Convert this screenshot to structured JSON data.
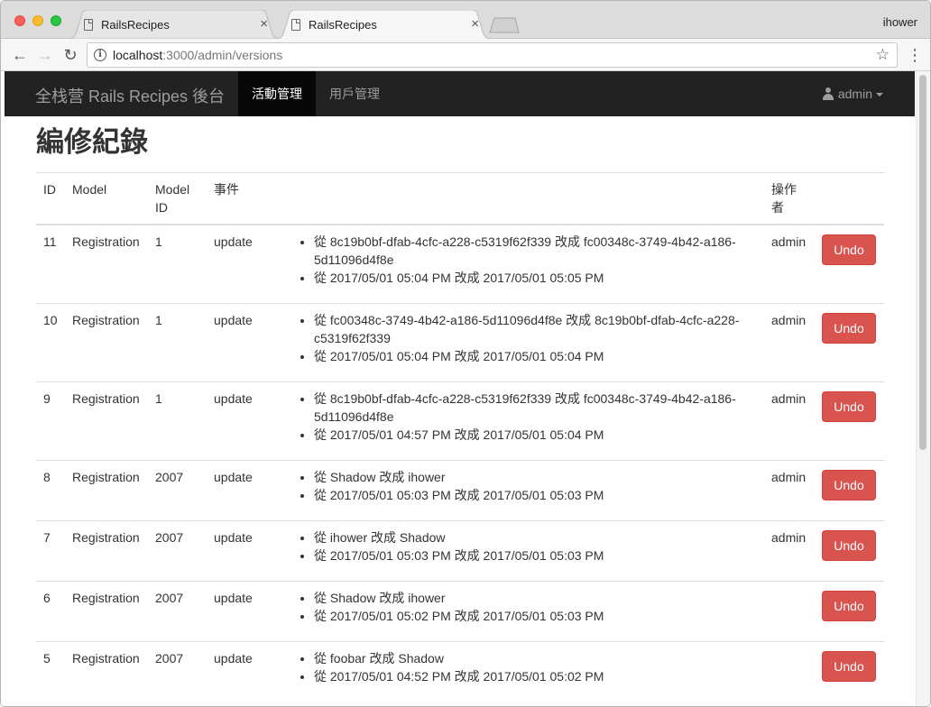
{
  "browser": {
    "tabs": [
      {
        "title": "RailsRecipes",
        "close": "×"
      },
      {
        "title": "RailsRecipes",
        "close": "×"
      }
    ],
    "profile_name": "ihower",
    "url_host": "localhost",
    "url_path": ":3000/admin/versions",
    "info_symbol": "i",
    "star_symbol": "☆",
    "menu_symbol": "⋮",
    "back_symbol": "←",
    "forward_symbol": "→",
    "reload_symbol": "↻"
  },
  "site": {
    "brand": "全栈营 Rails Recipes 後台",
    "nav": [
      {
        "label": "活動管理",
        "active": true
      },
      {
        "label": "用戶管理",
        "active": false
      }
    ],
    "user_menu_label": "admin"
  },
  "page": {
    "title": "編修紀錄",
    "columns": {
      "id": "ID",
      "model": "Model",
      "model_id_line1": "Model",
      "model_id_line2": "ID",
      "event": "事件",
      "changes": "",
      "operator_line1": "操作",
      "operator_line2": "者",
      "actions": ""
    },
    "undo_label": "Undo",
    "rows": [
      {
        "id": "11",
        "model": "Registration",
        "model_id": "1",
        "event": "update",
        "changes": [
          "從 8c19b0bf-dfab-4cfc-a228-c5319f62f339 改成 fc00348c-3749-4b42-a186-5d11096d4f8e",
          "從 2017/05/01 05:04 PM 改成 2017/05/01 05:05 PM"
        ],
        "operator": "admin"
      },
      {
        "id": "10",
        "model": "Registration",
        "model_id": "1",
        "event": "update",
        "changes": [
          "從 fc00348c-3749-4b42-a186-5d11096d4f8e 改成 8c19b0bf-dfab-4cfc-a228-c5319f62f339",
          "從 2017/05/01 05:04 PM 改成 2017/05/01 05:04 PM"
        ],
        "operator": "admin"
      },
      {
        "id": "9",
        "model": "Registration",
        "model_id": "1",
        "event": "update",
        "changes": [
          "從 8c19b0bf-dfab-4cfc-a228-c5319f62f339 改成 fc00348c-3749-4b42-a186-5d11096d4f8e",
          "從 2017/05/01 04:57 PM 改成 2017/05/01 05:04 PM"
        ],
        "operator": "admin"
      },
      {
        "id": "8",
        "model": "Registration",
        "model_id": "2007",
        "event": "update",
        "changes": [
          "從 Shadow 改成 ihower",
          "從 2017/05/01 05:03 PM 改成 2017/05/01 05:03 PM"
        ],
        "operator": "admin"
      },
      {
        "id": "7",
        "model": "Registration",
        "model_id": "2007",
        "event": "update",
        "changes": [
          "從 ihower 改成 Shadow",
          "從 2017/05/01 05:03 PM 改成 2017/05/01 05:03 PM"
        ],
        "operator": "admin"
      },
      {
        "id": "6",
        "model": "Registration",
        "model_id": "2007",
        "event": "update",
        "changes": [
          "從 Shadow 改成 ihower",
          "從 2017/05/01 05:02 PM 改成 2017/05/01 05:03 PM"
        ],
        "operator": ""
      },
      {
        "id": "5",
        "model": "Registration",
        "model_id": "2007",
        "event": "update",
        "changes": [
          "從 foobar 改成 Shadow",
          "從 2017/05/01 04:52 PM 改成 2017/05/01 05:02 PM"
        ],
        "operator": ""
      }
    ]
  },
  "colors": {
    "navbar_bg": "#222222",
    "navbar_active_bg": "#080808",
    "undo_bg": "#d9534f"
  }
}
